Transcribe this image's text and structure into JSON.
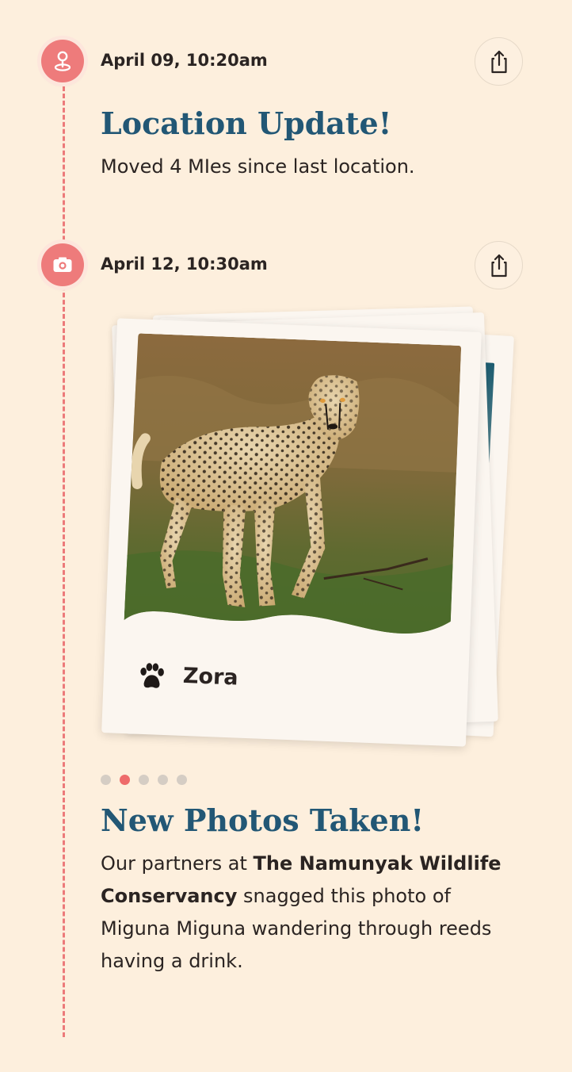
{
  "events": [
    {
      "type": "location",
      "icon": "location-pin-icon",
      "date": "April 09, 10:20am",
      "title": "Location Update!",
      "text": "Moved 4 MIes since last location."
    },
    {
      "type": "photo",
      "icon": "camera-icon",
      "date": "April 12, 10:30am",
      "title": "New Photos Taken!",
      "photo_caption": "Zora",
      "carousel": {
        "count": 5,
        "active_index": 1
      },
      "text_parts": [
        {
          "text": "Our partners at ",
          "bold": false
        },
        {
          "text": "The Namunyak Wildlife Conservancy",
          "bold": true
        },
        {
          "text": " snagged this photo of Miguna Miguna wandering through reeds having a drink.",
          "bold": false
        }
      ]
    }
  ],
  "colors": {
    "accent": "#ee7b7b",
    "title": "#225775",
    "background": "#fdefdd"
  }
}
